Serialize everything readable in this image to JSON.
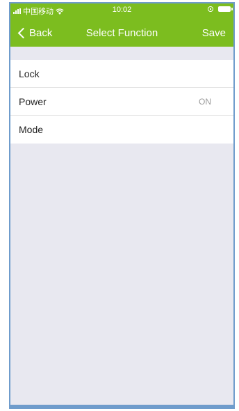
{
  "status_bar": {
    "carrier": "中国移动",
    "time": "10:02"
  },
  "nav": {
    "back_label": "Back",
    "title": "Select Function",
    "save_label": "Save"
  },
  "functions": [
    {
      "label": "Lock",
      "value": ""
    },
    {
      "label": "Power",
      "value": "ON"
    },
    {
      "label": "Mode",
      "value": ""
    }
  ],
  "colors": {
    "header": "#7cbd1f",
    "background": "#e8e8f0",
    "frame_border": "#6f9ccc"
  },
  "icons": [
    "signal-icon",
    "wifi-icon",
    "orientation-lock-icon",
    "battery-icon",
    "chevron-left-icon"
  ]
}
